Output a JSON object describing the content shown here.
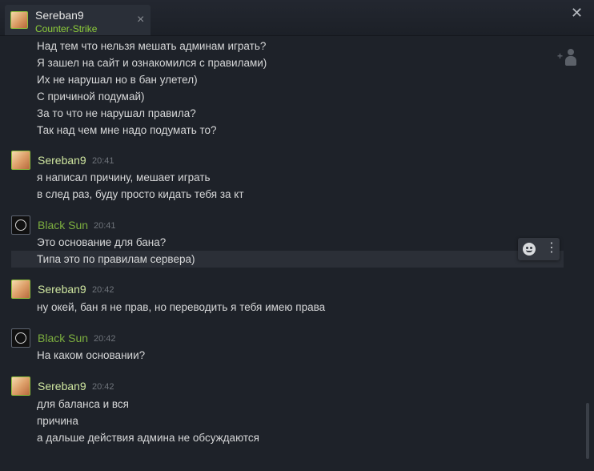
{
  "tab": {
    "name": "Sereban9",
    "game": "Counter-Strike",
    "close": "×"
  },
  "window": {
    "close": "✕"
  },
  "messages": [
    {
      "text": "Над тем что нельзя мешать админам играть?"
    },
    {
      "text": "Я зашел на сайт и ознакомился с правилами)"
    },
    {
      "text": "Их не нарушал но в бан улетел)"
    },
    {
      "text": "С причиной подумай)"
    },
    {
      "text": "За то что не нарушал правила?"
    },
    {
      "text": "Так над чем мне надо подумать то?"
    }
  ],
  "groups": [
    {
      "author": "Sereban9",
      "time": "20:41",
      "lines": [
        "я написал причину, мешает играть",
        "в след раз, буду просто кидать тебя за кт"
      ]
    },
    {
      "author": "Black Sun",
      "time": "20:41",
      "lines": [
        "Это основание для бана?",
        "Типа это по правилам сервера)"
      ]
    },
    {
      "author": "Sereban9",
      "time": "20:42",
      "lines": [
        "ну окей, бан я не прав, но переводить я тебя имею права"
      ]
    },
    {
      "author": "Black Sun",
      "time": "20:42",
      "lines": [
        "На каком основании?"
      ]
    },
    {
      "author": "Sereban9",
      "time": "20:42",
      "lines": [
        "для баланса и вся",
        "причина",
        "а дальше действия админа не обсуждаются"
      ]
    }
  ],
  "react_menu": {
    "more": "⋮"
  },
  "colors": {
    "accent_green": "#8fcf3a",
    "self_name": "#cfe6a0",
    "friend_name": "#7cae3f"
  }
}
